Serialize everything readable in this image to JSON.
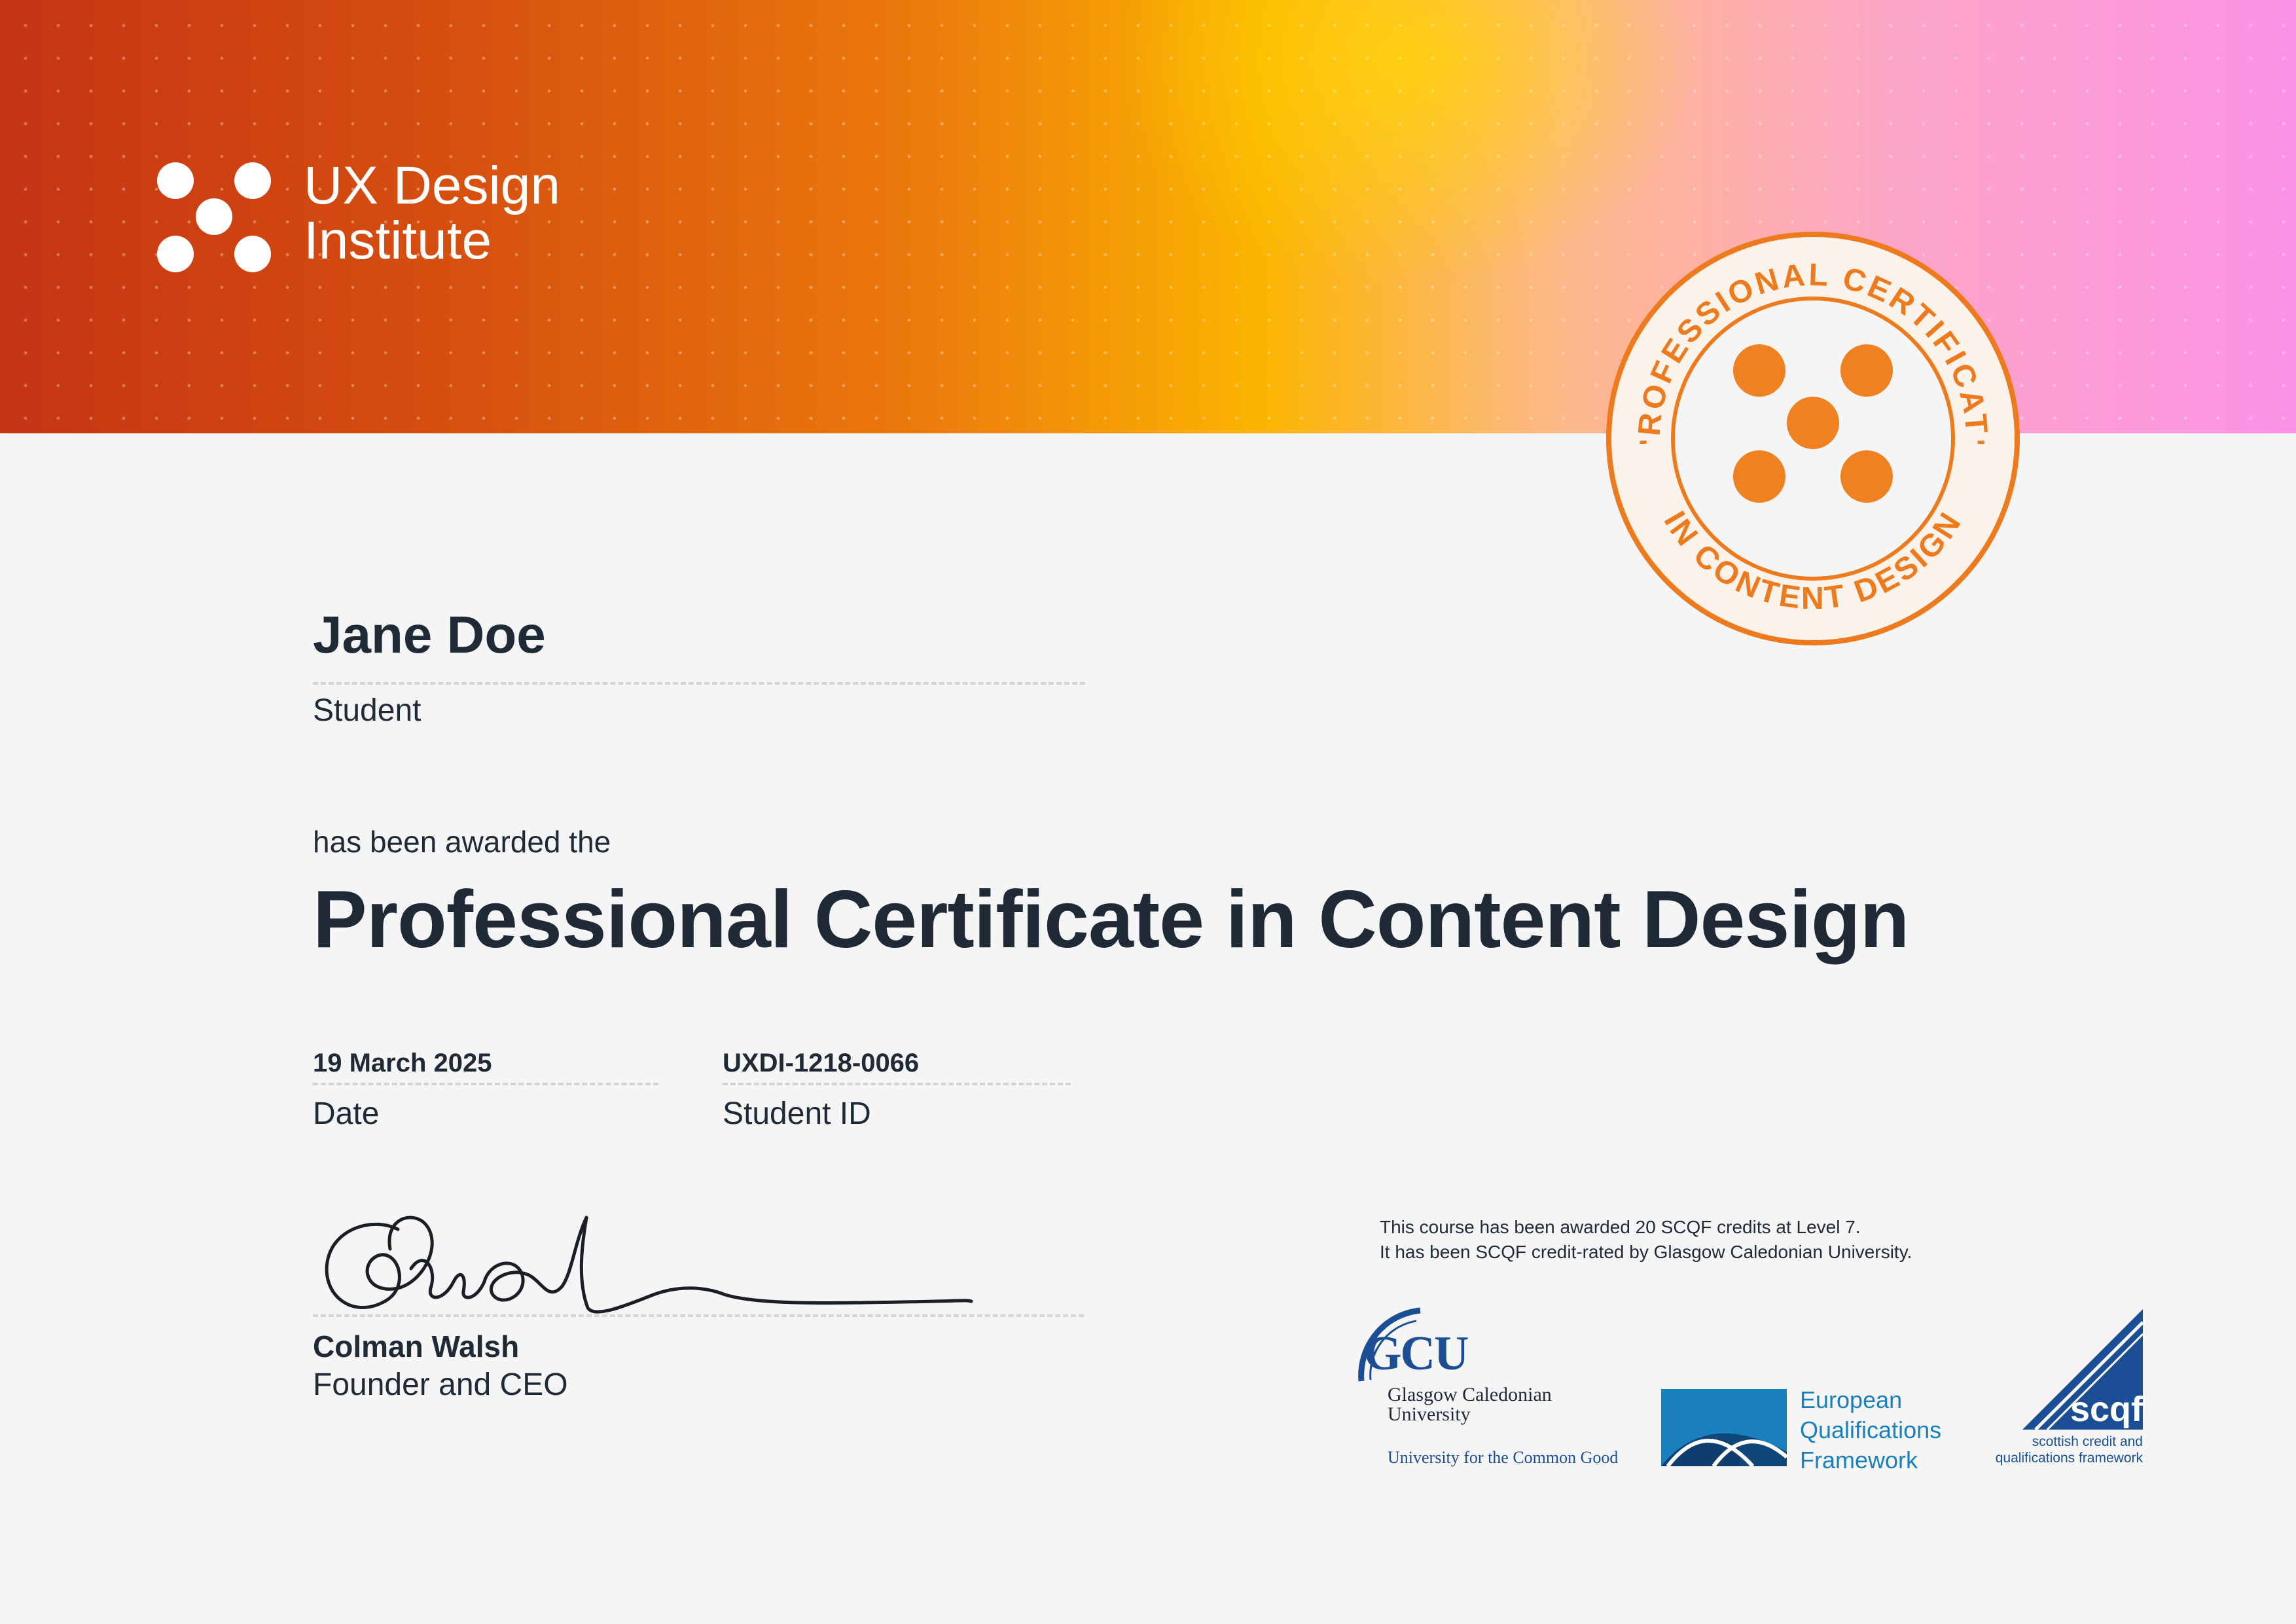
{
  "brand": {
    "name_line1": "UX Design",
    "name_line2": "Institute"
  },
  "seal": {
    "text_top": "PROFESSIONAL CERTIFICATE",
    "text_bottom": "IN CONTENT DESIGN",
    "color": "#ee7a1e"
  },
  "recipient": {
    "name": "Jane Doe",
    "role": "Student"
  },
  "award": {
    "intro": "has been awarded the",
    "course": "Professional Certificate in Content Design"
  },
  "details": {
    "date_value": "19 March 2025",
    "date_label": "Date",
    "id_value": "UXDI-1218-0066",
    "id_label": "Student ID"
  },
  "signatory": {
    "name": "Colman Walsh",
    "title": "Founder and CEO"
  },
  "accreditation": {
    "line1": "This course has been awarded 20 SCQF credits at Level 7.",
    "line2": "It has been SCQF credit-rated by Glasgow Caledonian University."
  },
  "partners": {
    "gcu": {
      "abbr": "GCU",
      "name_line1": "Glasgow Caledonian",
      "name_line2": "University",
      "motto": "University for the Common Good"
    },
    "eqf": {
      "line1": "European",
      "line2": "Qualifications",
      "line3": "Framework"
    },
    "scqf": {
      "abbr": "scqf",
      "line1": "scottish credit and",
      "line2": "qualifications framework"
    }
  },
  "colors": {
    "text": "#1f2a36",
    "accent_orange": "#ee7a1e",
    "gcu_blue": "#1c4e96",
    "eqf_blue": "#1a7fbd"
  }
}
